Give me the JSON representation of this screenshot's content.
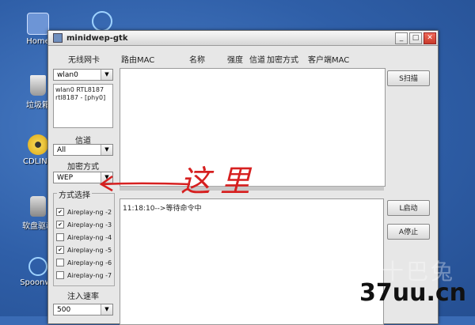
{
  "desktop": {
    "icons": [
      {
        "label": "Home"
      },
      {
        "label": "垃圾箱"
      },
      {
        "label": "CDLINU"
      },
      {
        "label": "软盘驱动"
      },
      {
        "label": "Spoonwe"
      }
    ]
  },
  "window": {
    "title": "minidwep-gtk",
    "buttons": {
      "minimize": "_",
      "maximize": "□",
      "close": "✕"
    }
  },
  "left_panel": {
    "wireless_card_label": "无线网卡",
    "interface_value": "wlan0",
    "card_list": [
      "wlan0 RTL8187",
      "rtl8187 - [phy0]"
    ],
    "channel_label": "信道",
    "channel_value": "All",
    "encryption_label": "加密方式",
    "encryption_value": "WEP",
    "method_label": "方式选择",
    "methods": [
      {
        "label": "Aireplay-ng -2",
        "checked": true
      },
      {
        "label": "Aireplay-ng -3",
        "checked": true
      },
      {
        "label": "Aireplay-ng -4",
        "checked": false
      },
      {
        "label": "Aireplay-ng -5",
        "checked": true
      },
      {
        "label": "Aireplay-ng -6",
        "checked": false
      },
      {
        "label": "Aireplay-ng -7",
        "checked": false
      }
    ],
    "rate_label": "注入速率",
    "rate_value": "500"
  },
  "table": {
    "columns": [
      "路由MAC",
      "名称",
      "强度",
      "信道",
      "加密方式",
      "客户端MAC"
    ]
  },
  "log": {
    "lines": [
      "11:18:10-->等待命令中"
    ]
  },
  "right_buttons": {
    "scan": "S扫描",
    "start": "L启动",
    "stop": "A停止"
  },
  "annotation": {
    "text": "这里",
    "color": "#d62020"
  },
  "watermark": {
    "text": "37uu.cn",
    "faint_text": "十巴兔"
  },
  "colors": {
    "desktop_bg": "#3a6bb5",
    "window_bg": "#e7e7e7",
    "annotation_red": "#d62020"
  }
}
